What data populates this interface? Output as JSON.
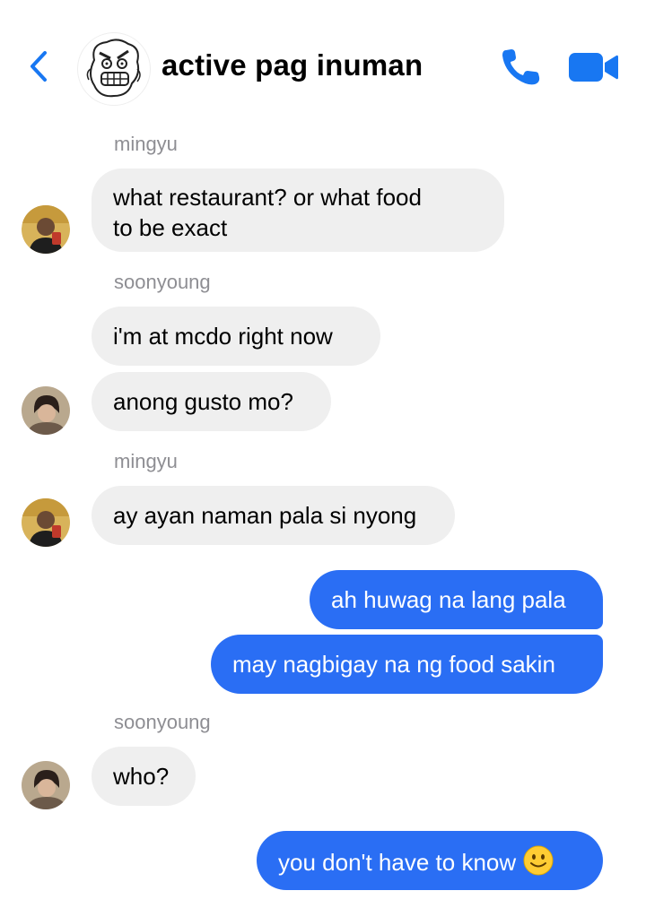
{
  "header": {
    "title": "active pag inuman",
    "back_icon": "chevron-left-icon",
    "call_icon": "phone-icon",
    "video_icon": "video-camera-icon",
    "accent": "#1877f2"
  },
  "colors": {
    "outgoing_bubble": "#2a6ef4",
    "incoming_bubble": "#efefef",
    "sender_name": "#8e8e93"
  },
  "messages": [
    {
      "sender": "mingyu"
    },
    {
      "text_line1": "what restaurant? or what food",
      "text_line2": "to be exact"
    },
    {
      "sender": "soonyoung"
    },
    {
      "text": "i'm at mcdo right now"
    },
    {
      "text": "anong gusto mo?"
    },
    {
      "sender": "mingyu"
    },
    {
      "text": "ay ayan naman pala si nyong"
    },
    {
      "text": "ah huwag na lang pala"
    },
    {
      "text": "may nagbigay na ng food sakin"
    },
    {
      "sender": "soonyoung"
    },
    {
      "text": "who?"
    },
    {
      "text": "you don't have to know",
      "emoji": "slightly-smiling-face"
    }
  ]
}
